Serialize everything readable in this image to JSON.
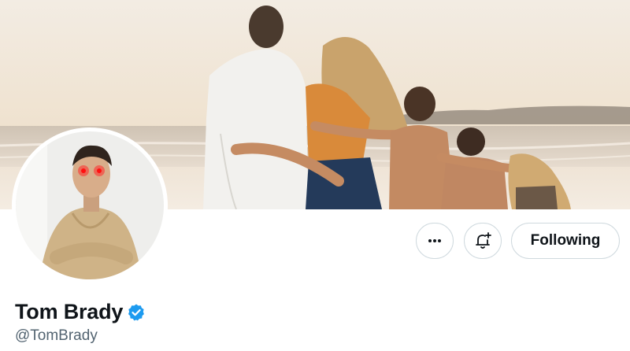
{
  "profile": {
    "display_name": "Tom Brady",
    "handle": "@TomBrady",
    "verified": true
  },
  "actions": {
    "more_icon": "more-horizontal-icon",
    "notify_icon": "bell-plus-icon",
    "following_label": "Following"
  },
  "colors": {
    "verified_badge": "#1d9bf0",
    "handle_text": "#536471",
    "name_text": "#0f1419",
    "button_border": "#cfd9de"
  }
}
